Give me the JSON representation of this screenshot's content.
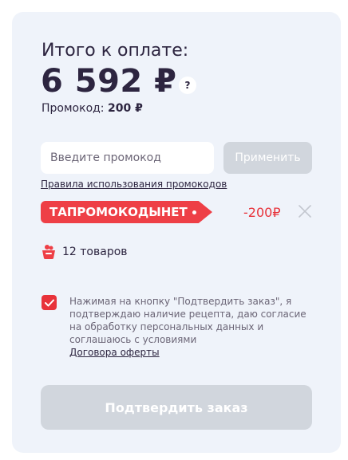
{
  "summary": {
    "title": "Итого к оплате:",
    "total": "6 592 ₽",
    "help_symbol": "?",
    "promo_label": "Промокод:",
    "promo_value": "200 ₽"
  },
  "promo": {
    "input_placeholder": "Введите промокод",
    "apply_label": "Применить",
    "rules_link": "Правила использования промокодов",
    "applied_code": "ТАПРОМОКОДЫНЕТ",
    "discount": "-200₽"
  },
  "cart": {
    "items_count": "12 товаров"
  },
  "consent": {
    "checked": true,
    "text": "Нажимая на кнопку \"Подтвердить заказ\", я подтверждаю наличие рецепта, даю согласие на обработку персональных данных и соглашаюсь с условиями",
    "offer_link": "Договора оферты"
  },
  "actions": {
    "confirm_label": "Подтвердить заказ"
  },
  "colors": {
    "accent": "#ee3f46",
    "card_background": "#eff3fa",
    "disabled_button": "#d1d6dd"
  }
}
